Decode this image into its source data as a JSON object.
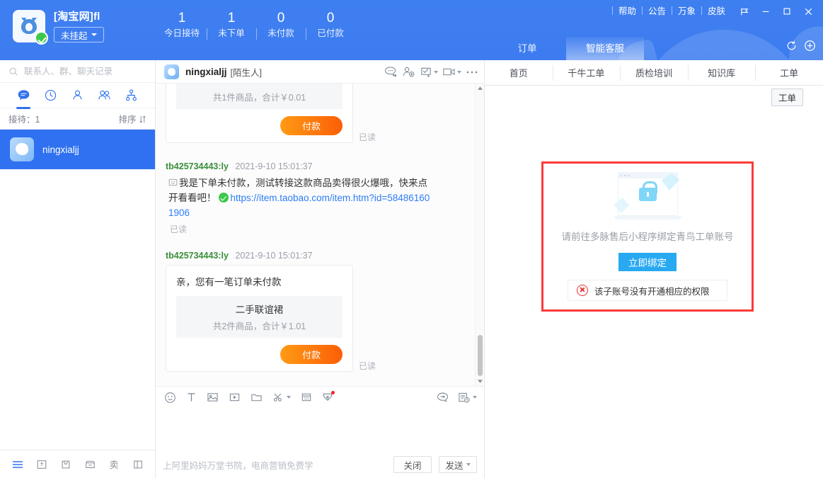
{
  "header": {
    "shop_name": "[淘宝网]fl",
    "status_label": "未挂起",
    "stats": [
      {
        "num": "1",
        "label": "今日接待"
      },
      {
        "num": "1",
        "label": "未下单"
      },
      {
        "num": "0",
        "label": "未付款"
      },
      {
        "num": "0",
        "label": "已付款"
      }
    ],
    "links": [
      "帮助",
      "公告",
      "万象",
      "皮肤"
    ],
    "window_controls": [
      "pin-icon",
      "minimize-icon",
      "maximize-icon",
      "close-icon"
    ],
    "main_tabs": [
      {
        "label": "订单",
        "active": false
      },
      {
        "label": "智能客服",
        "active": true
      }
    ],
    "header_icons": [
      "refresh-icon",
      "add-icon"
    ]
  },
  "sidebar": {
    "search_placeholder": "联系人、群、聊天记录",
    "tab_icons": [
      "chat-icon",
      "recent-icon",
      "contact-icon",
      "group-icon",
      "org-icon"
    ],
    "list_header": {
      "count_label": "接待：1",
      "sort_label": "排序"
    },
    "conversations": [
      {
        "name": "ningxialjj",
        "active": true
      }
    ],
    "bottom_icons": [
      "menu-icon",
      "note-icon",
      "bag-icon",
      "shop-icon",
      "sell-icon",
      "layout-icon"
    ],
    "bottom_sell_label": "卖"
  },
  "chat": {
    "contact_name": "ningxialjj",
    "contact_tag": "[陌生人]",
    "head_icons": [
      "quick-reply-icon",
      "add-friend-icon",
      "todo-icon",
      "video-icon",
      "more-icon"
    ],
    "messages": [
      {
        "type": "card",
        "partial": true,
        "goods_summary": "共1件商品，合计￥0.01",
        "pay_label": "付款",
        "read_label": "已读"
      },
      {
        "type": "text",
        "uid": "tb425734443:ly",
        "time": "2021-9-10 15:01:37",
        "text": "我是下单未付款，测试转接这款商品卖得很火爆哦，快来点开看看吧！",
        "link": "https://item.taobao.com/item.htm?id=584861601906",
        "read_label": "已读"
      },
      {
        "type": "card",
        "uid": "tb425734443:ly",
        "time": "2021-9-10 15:01:37",
        "title": "亲，您有一笔订单未付款",
        "goods_name": "二手联谊裙",
        "goods_summary": "共2件商品，合计￥1.01",
        "pay_label": "付款",
        "read_label": "已读"
      }
    ]
  },
  "composer": {
    "tool_icons": [
      "emoji-icon",
      "text-format-icon",
      "image-icon",
      "video-clip-icon",
      "folder-icon",
      "scissors-icon",
      "calendar-icon",
      "coupon-icon"
    ],
    "right_icons": [
      "quick-phrase-icon",
      "history-icon"
    ],
    "input_value": "",
    "hint": "上阿里妈妈万堂书院，电商营销免费学",
    "close_label": "关闭",
    "send_label": "发送"
  },
  "right_panel": {
    "tabs": [
      "首页",
      "千牛工单",
      "质检培训",
      "知识库",
      "工单"
    ],
    "pill_label": "工单",
    "bind": {
      "illustration": "lock-window-icon",
      "message": "请前往多脉售后小程序绑定青鸟工单账号",
      "button_label": "立即绑定",
      "error_text": "该子账号没有开通相应的权限",
      "border_color": "#fb3b3b"
    }
  },
  "colors": {
    "brand_blue": "#3d7cf0",
    "accent_blue": "#2f71f0",
    "pay_orange": "#fb5e08",
    "bind_blue": "#29a9f2",
    "error_red": "#e8332f"
  }
}
